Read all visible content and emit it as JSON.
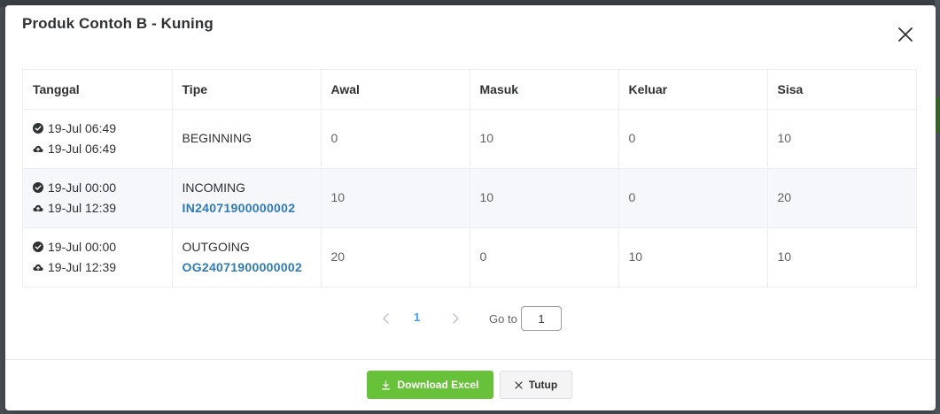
{
  "modal": {
    "title": "Produk Contoh B - Kuning"
  },
  "table": {
    "headers": [
      "Tanggal",
      "Tipe",
      "Awal",
      "Masuk",
      "Keluar",
      "Sisa"
    ],
    "rows": [
      {
        "confirmed": "19-Jul 06:49",
        "uploaded": "19-Jul 06:49",
        "type": "BEGINNING",
        "ref": "",
        "awal": "0",
        "masuk": "10",
        "keluar": "0",
        "sisa": "10"
      },
      {
        "confirmed": "19-Jul 00:00",
        "uploaded": "19-Jul 12:39",
        "type": "INCOMING",
        "ref": "IN24071900000002",
        "awal": "10",
        "masuk": "10",
        "keluar": "0",
        "sisa": "20"
      },
      {
        "confirmed": "19-Jul 00:00",
        "uploaded": "19-Jul 12:39",
        "type": "OUTGOING",
        "ref": "OG24071900000002",
        "awal": "20",
        "masuk": "0",
        "keluar": "10",
        "sisa": "10"
      }
    ]
  },
  "pagination": {
    "current_page": "1",
    "goto_label": "Go to",
    "goto_value": "1"
  },
  "footer": {
    "download_label": "Download Excel",
    "close_label": "Tutup"
  },
  "icons": {
    "confirmed": "check-circle-icon",
    "uploaded": "cloud-upload-icon",
    "close": "close-icon",
    "download": "download-icon",
    "prev": "chevron-left-icon",
    "next": "chevron-right-icon"
  },
  "colors": {
    "primary_button": "#67c23a",
    "link": "#2f7bb7",
    "active_page": "#409eff"
  }
}
